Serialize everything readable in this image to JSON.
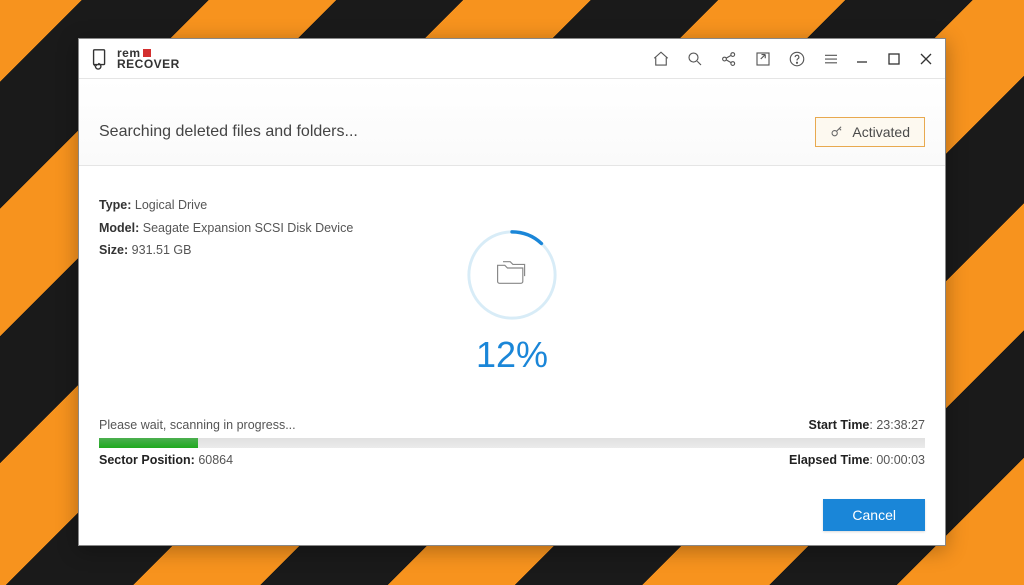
{
  "app": {
    "name_top": "rem",
    "name_bottom": "RECOVER"
  },
  "header": {
    "title": "Searching deleted files and folders...",
    "activated_label": "Activated"
  },
  "drive": {
    "type_label": "Type:",
    "type_value": "Logical Drive",
    "model_label": "Model:",
    "model_value": "Seagate Expansion SCSI Disk Device",
    "size_label": "Size:",
    "size_value": "931.51 GB"
  },
  "progress": {
    "percent_text": "12%",
    "percent_value": 12,
    "wait_text": "Please wait, scanning in progress...",
    "start_time_label": "Start Time",
    "start_time_value": ": 23:38:27",
    "sector_label": "Sector Position:",
    "sector_value": "60864",
    "elapsed_label": "Elapsed Time",
    "elapsed_value": ": 00:00:03"
  },
  "footer": {
    "cancel_label": "Cancel"
  }
}
